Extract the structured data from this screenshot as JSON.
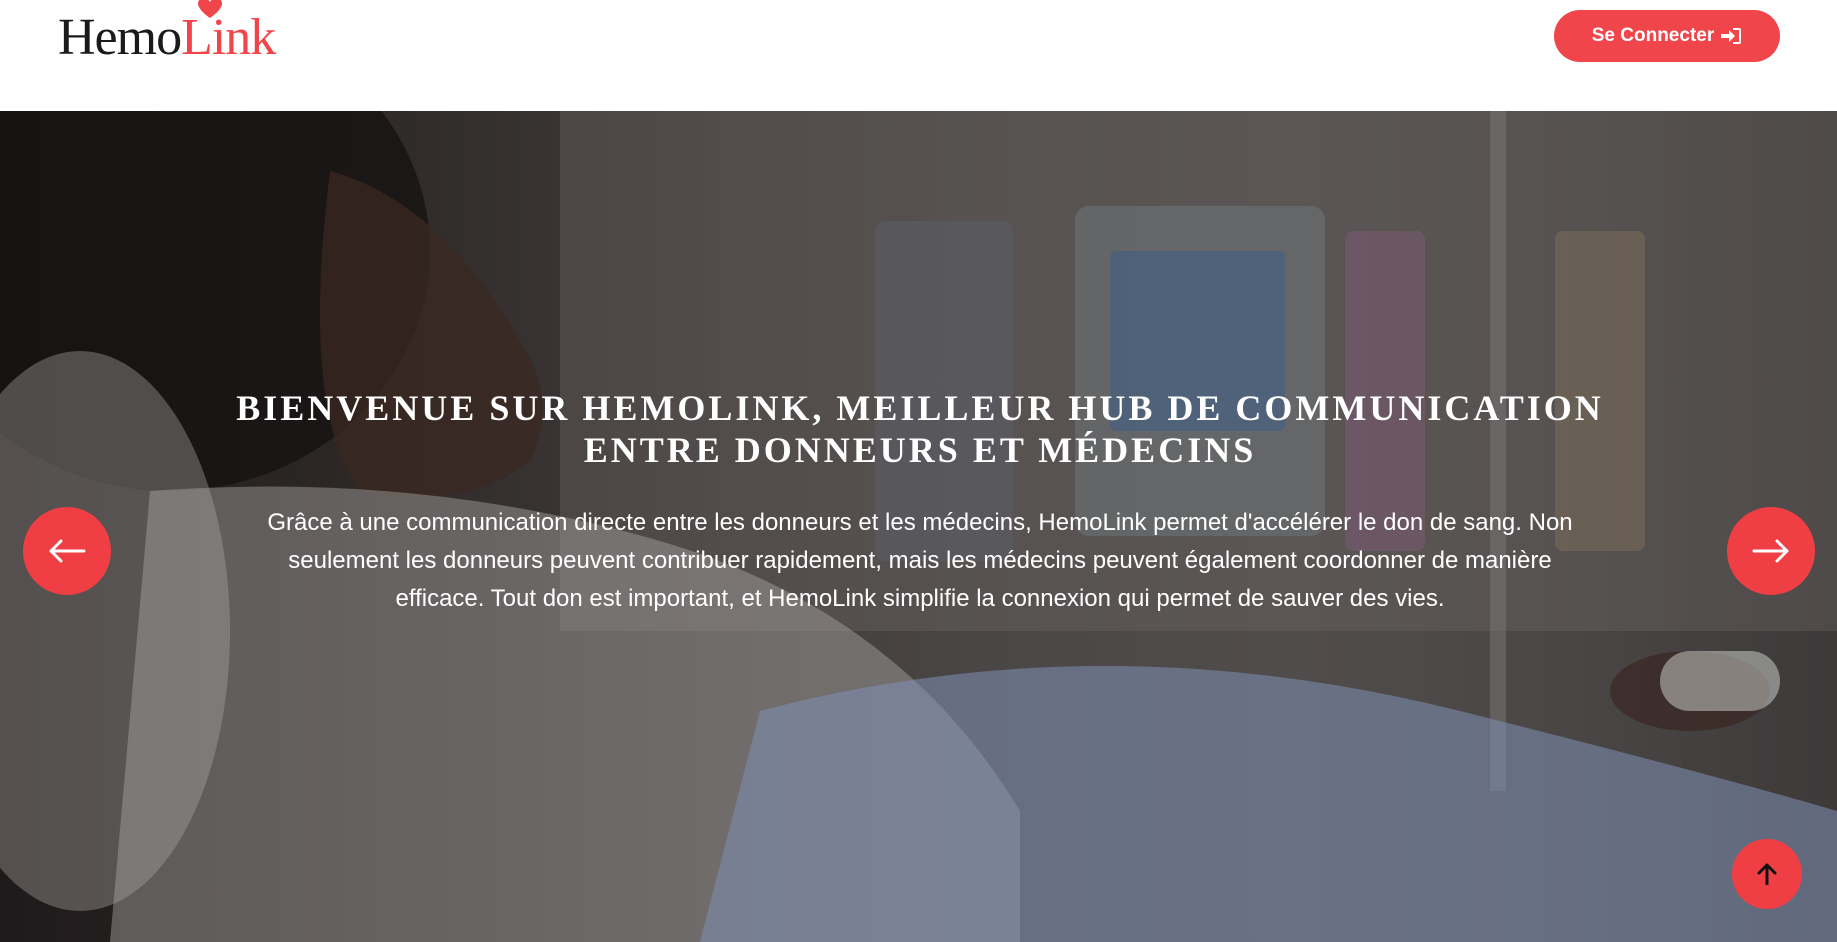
{
  "navbar": {
    "logo": {
      "part1": "Hemo",
      "part2": "Link"
    },
    "connect_button": {
      "label": "Se Connecter",
      "icon": "sign-in-icon"
    }
  },
  "hero": {
    "title": "BIENVENUE SUR HEMOLINK, MEILLEUR HUB DE COMMUNICATION ENTRE DONNEURS ET MÉDECINS",
    "description": "Grâce à une communication directe entre les donneurs et les médecins, HemoLink permet d'accélérer le don de sang. Non seulement les donneurs peuvent contribuer rapidement, mais les médecins peuvent également coordonner de manière efficace. Tout don est important, et HemoLink simplifie la connexion qui permet de sauver des vies.",
    "prev_icon": "arrow-left-icon",
    "next_icon": "arrow-right-icon"
  },
  "back_to_top": {
    "icon": "arrow-up-icon"
  },
  "colors": {
    "accent": "#f0464b",
    "dark_text": "#1a1a1a",
    "overlay": "#141216"
  }
}
